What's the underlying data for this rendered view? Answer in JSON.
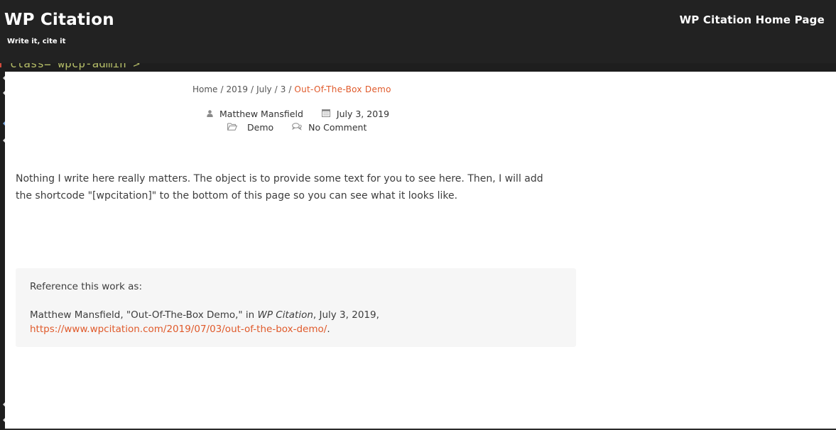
{
  "header": {
    "site_title": "WP Citation",
    "tagline": "Write it, cite it",
    "home_link": "WP Citation Home Page"
  },
  "backdrop": {
    "code_line": "class= wpcp-admin >"
  },
  "breadcrumb": {
    "items": [
      "Home",
      "2019",
      "July",
      "3"
    ],
    "separator": "/",
    "current": "Out-Of-The-Box Demo"
  },
  "meta": {
    "author": "Matthew Mansfield",
    "date": "July 3, 2019",
    "category": "Demo",
    "comments": "No Comment"
  },
  "post": {
    "body": "Nothing I write here really matters. The object is to provide some text for you to see here. Then, I will add the shortcode \"[wpcitation]\" to the bottom of this page so you can see what it looks like."
  },
  "citation": {
    "heading": "Reference this work as:",
    "prefix": "Matthew Mansfield, \"Out-Of-The-Box Demo,\" in ",
    "site_name": "WP Citation",
    "date_part": ", July 3, 2019,",
    "url": "https://www.wpcitation.com/2019/07/03/out-of-the-box-demo/",
    "suffix": "."
  },
  "colors": {
    "header_bg": "#222222",
    "accent": "#e05a2b",
    "cite_box_bg": "#f6f6f6",
    "text": "#3d3d3d"
  },
  "icons": {
    "author": "user-icon",
    "date": "calendar-icon",
    "category": "folder-icon",
    "comments": "comment-icon"
  }
}
